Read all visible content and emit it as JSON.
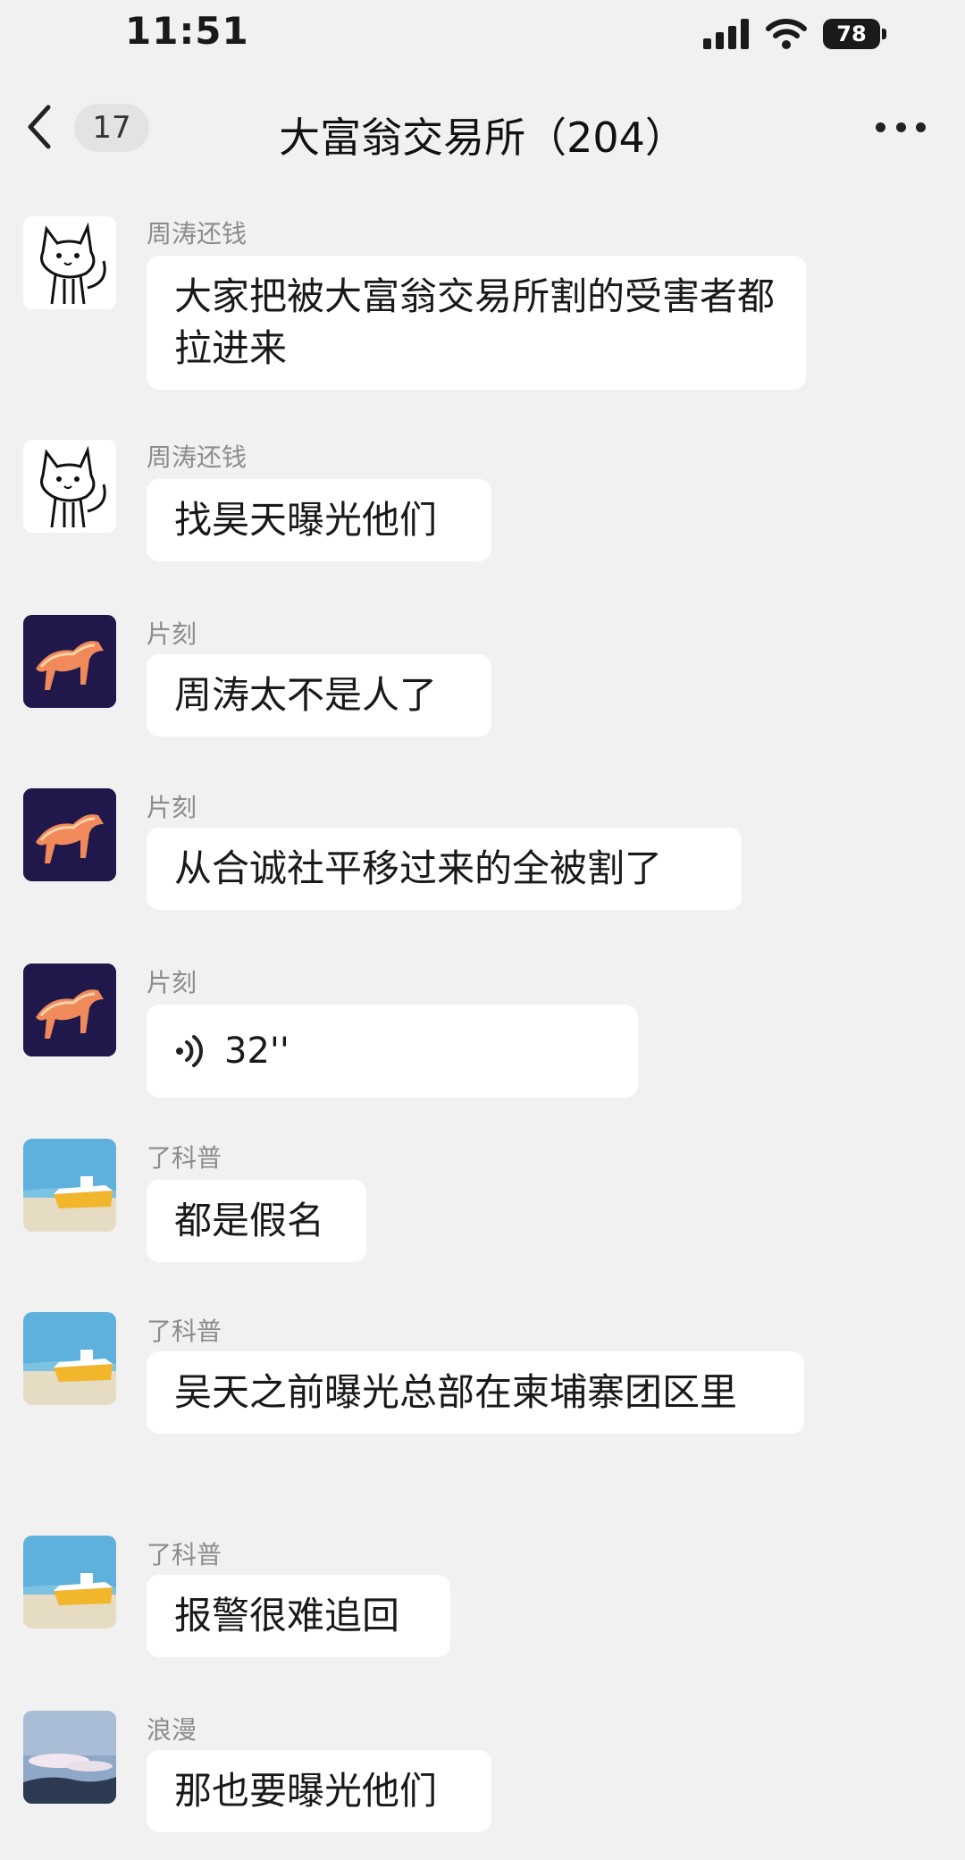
{
  "status_bar": {
    "time": "11:51",
    "battery": "78"
  },
  "nav": {
    "unread_count": "17",
    "title": "大富翁交易所（204）"
  },
  "messages": [
    {
      "sender": "周涛还钱",
      "text": "大家把被大富翁交易所割的受害者都拉进来",
      "avatar": "cat-sketch"
    },
    {
      "sender": "周涛还钱",
      "text": "找昊天曝光他们",
      "avatar": "cat-sketch"
    },
    {
      "sender": "片刻",
      "text": "周涛太不是人了",
      "avatar": "fire-horse"
    },
    {
      "sender": "片刻",
      "text": "从合诚社平移过来的全被割了",
      "avatar": "fire-horse"
    },
    {
      "sender": "片刻",
      "voice_duration": "32''",
      "avatar": "fire-horse"
    },
    {
      "sender": "了科普",
      "text": "都是假名",
      "avatar": "boat-sea"
    },
    {
      "sender": "了科普",
      "text": "吴天之前曝光总部在柬埔寨团区里",
      "avatar": "boat-sea"
    },
    {
      "sender": "了科普",
      "text": "报警很难追回",
      "avatar": "boat-sea"
    },
    {
      "sender": "浪漫",
      "text": "那也要曝光他们",
      "avatar": "sky-landscape"
    }
  ]
}
